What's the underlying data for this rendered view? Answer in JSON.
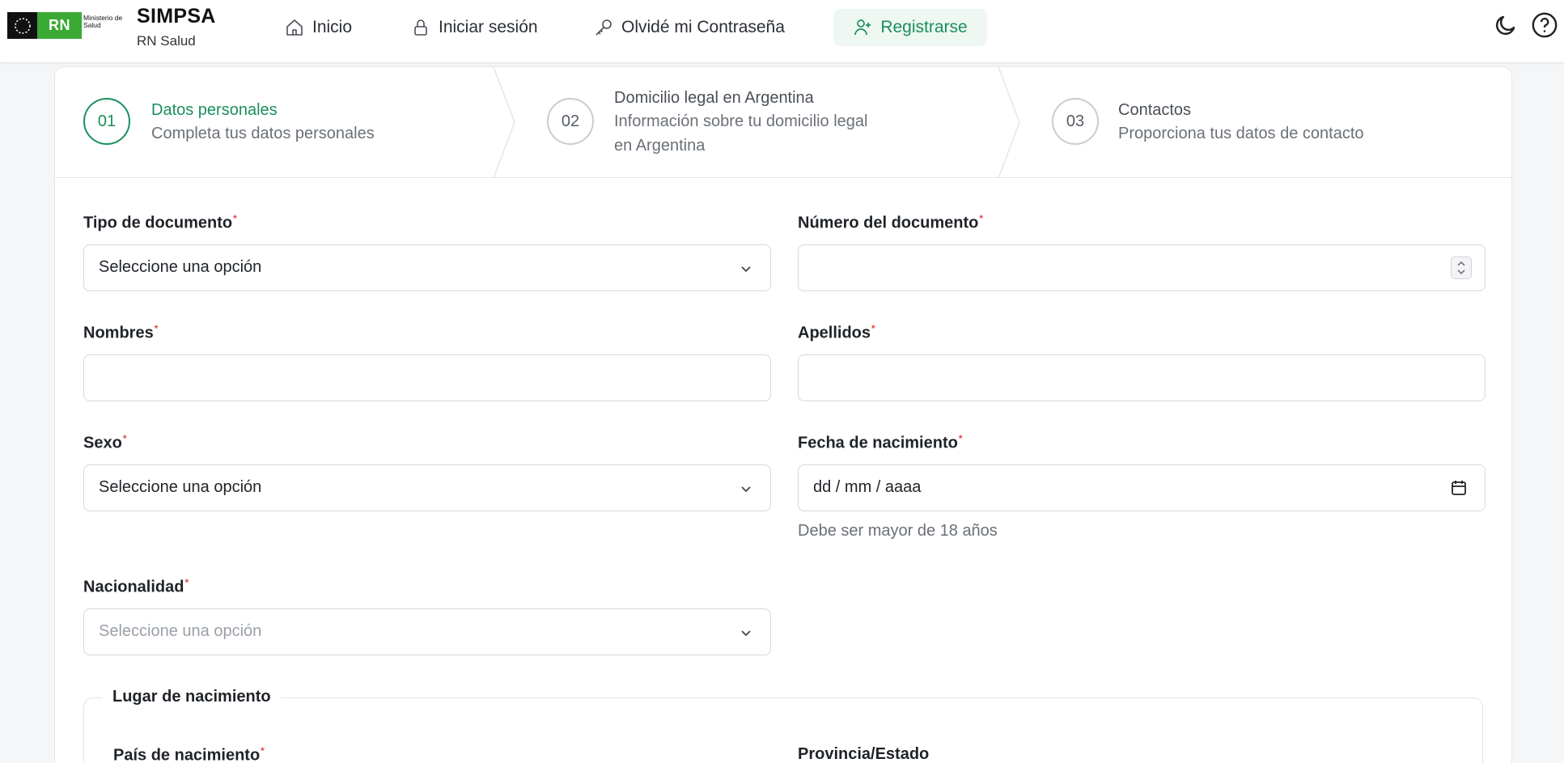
{
  "header": {
    "ministerio": "Ministerio de Salud",
    "logo_badge": "RN",
    "brand_title": "SIMPSA",
    "brand_sub": "RN Salud",
    "nav": {
      "inicio": "Inicio",
      "login": "Iniciar sesión",
      "forgot": "Olvidé mi Contraseña",
      "register": "Registrarse"
    },
    "accent_color": "#1a8f5c"
  },
  "stepper": {
    "steps": [
      {
        "number": "01",
        "title": "Datos personales",
        "desc": "Completa tus datos personales",
        "active": true
      },
      {
        "number": "02",
        "title": "Domicilio legal en Argentina",
        "desc_line1": "Información sobre tu domicilio legal",
        "desc_line2": "en Argentina",
        "active": false
      },
      {
        "number": "03",
        "title": "Contactos",
        "desc": "Proporciona tus datos de contacto",
        "active": false
      }
    ]
  },
  "form": {
    "tipo_documento": {
      "label": "Tipo de documento",
      "value": "Seleccione una opción"
    },
    "numero_documento": {
      "label": "Número del documento",
      "value": ""
    },
    "nombres": {
      "label": "Nombres",
      "value": ""
    },
    "apellidos": {
      "label": "Apellidos",
      "value": ""
    },
    "sexo": {
      "label": "Sexo",
      "value": "Seleccione una opción"
    },
    "fecha_nacimiento": {
      "label": "Fecha de nacimiento",
      "value": "dd / mm / aaaa",
      "hint": "Debe ser mayor de 18 años"
    },
    "nacionalidad": {
      "label": "Nacionalidad",
      "placeholder": "Seleccione una opción"
    },
    "lugar_nacimiento": {
      "legend": "Lugar de nacimiento",
      "pais_label": "País de nacimiento",
      "provincia_label": "Provincia/Estado"
    },
    "required_mark": "*"
  }
}
